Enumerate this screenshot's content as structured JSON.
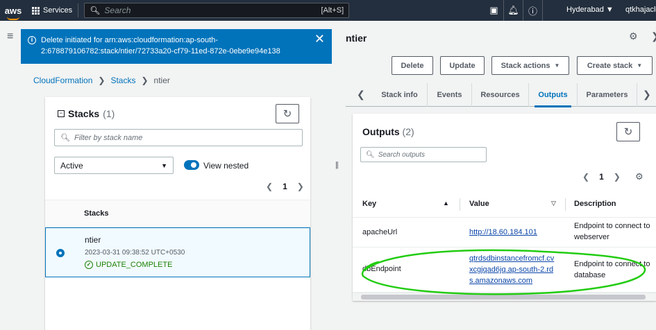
{
  "topbar": {
    "logo_text": "aws",
    "services_label": "Services",
    "search_placeholder": "Search",
    "search_shortcut": "[Alt+S]",
    "region": "Hyderabad ▼",
    "user": "qtkhajaclo"
  },
  "flash": {
    "message": "Delete initiated for arn:aws:cloudformation:ap-south-2:678879106782:stack/ntier/72733a20-cf79-11ed-872e-0ebe9e94e138"
  },
  "breadcrumb": [
    "CloudFormation",
    "Stacks",
    "ntier"
  ],
  "stacks_panel": {
    "title": "Stacks",
    "count": "(1)",
    "filter_placeholder": "Filter by stack name",
    "status_filter": "Active",
    "view_nested_label": "View nested",
    "page": "1",
    "column_header": "Stacks",
    "rows": [
      {
        "name": "ntier",
        "created": "2023-03-31 09:38:52 UTC+0530",
        "status": "UPDATE_COMPLETE"
      }
    ]
  },
  "stack_detail": {
    "title": "ntier",
    "buttons": {
      "delete": "Delete",
      "update": "Update",
      "stack_actions": "Stack actions",
      "create_stack": "Create stack"
    },
    "tabs": [
      "Stack info",
      "Events",
      "Resources",
      "Outputs",
      "Parameters"
    ],
    "active_tab": "Outputs"
  },
  "outputs": {
    "title": "Outputs",
    "count": "(2)",
    "search_placeholder": "Search outputs",
    "page": "1",
    "columns": {
      "key": "Key",
      "value": "Value",
      "description": "Description"
    },
    "rows": [
      {
        "key": "apacheUrl",
        "value": "http://18.60.184.101",
        "description": "Endpoint to connect to webserver"
      },
      {
        "key": "dbEndpoint",
        "value": "qtrdsdbinstancefromcf.cvxcgjqad6jq.ap-south-2.rds.amazonaws.com",
        "description": "Endpoint to connect to database"
      }
    ]
  },
  "annotation_color": "#22cc11"
}
